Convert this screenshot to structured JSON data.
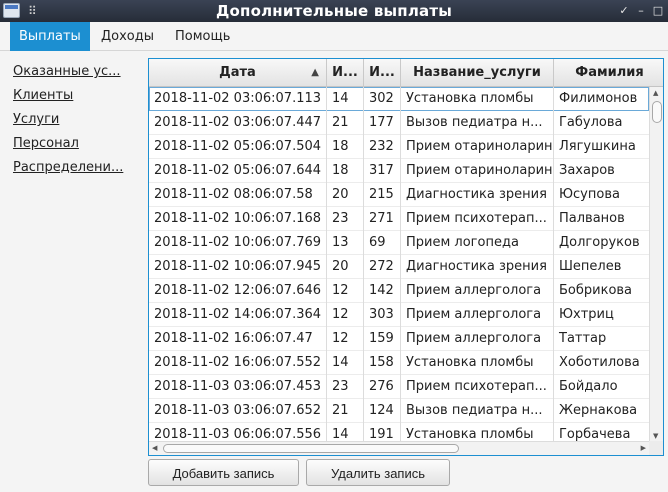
{
  "window": {
    "title": "Дополнительные выплаты",
    "grip_icon": "⠿",
    "pin_icon": "✓",
    "min_icon": "–",
    "max_icon": "□"
  },
  "menu": {
    "items": [
      "Выплаты",
      "Доходы",
      "Помощь"
    ],
    "active": "Выплаты"
  },
  "sidebar": {
    "links": [
      "Оказанные ус...",
      "Клиенты",
      "Услуги",
      "Персонал",
      "Распределени..."
    ]
  },
  "table": {
    "columns": [
      "Дата",
      "И...",
      "И...",
      "Название_услуги",
      "Фамилия"
    ],
    "sorted_column": "Дата",
    "sort_arrow": "▲",
    "rows": [
      [
        "2018-11-02 03:06:07.113",
        "14",
        "302",
        "Установка пломбы",
        "Филимонов"
      ],
      [
        "2018-11-02 03:06:07.447",
        "21",
        "177",
        "Вызов педиатра н...",
        "Габулова"
      ],
      [
        "2018-11-02 05:06:07.504",
        "18",
        "232",
        "Прием отариноларин...",
        "Лягушкина"
      ],
      [
        "2018-11-02 05:06:07.644",
        "18",
        "317",
        "Прием отариноларин...",
        "Захаров"
      ],
      [
        "2018-11-02 08:06:07.58",
        "20",
        "215",
        "Диагностика зрения",
        "Юсупова"
      ],
      [
        "2018-11-02 10:06:07.168",
        "23",
        "271",
        "Прием психотерап...",
        "Палванов"
      ],
      [
        "2018-11-02 10:06:07.769",
        "13",
        "69",
        "Прием логопеда",
        "Долгоруков"
      ],
      [
        "2018-11-02 10:06:07.945",
        "20",
        "272",
        "Диагностика зрения",
        "Шепелев"
      ],
      [
        "2018-11-02 12:06:07.646",
        "12",
        "142",
        "Прием аллерголога",
        "Бобрикова"
      ],
      [
        "2018-11-02 14:06:07.364",
        "12",
        "303",
        "Прием аллерголога",
        "Юхтриц"
      ],
      [
        "2018-11-02 16:06:07.47",
        "12",
        "159",
        "Прием аллерголога",
        "Таттар"
      ],
      [
        "2018-11-02 16:06:07.552",
        "14",
        "158",
        "Установка пломбы",
        "Хоботилова"
      ],
      [
        "2018-11-03 03:06:07.453",
        "23",
        "276",
        "Прием психотерап...",
        "Бойдало"
      ],
      [
        "2018-11-03 03:06:07.652",
        "21",
        "124",
        "Вызов педиатра н...",
        "Жернакова"
      ],
      [
        "2018-11-03 06:06:07.556",
        "14",
        "191",
        "Установка пломбы",
        "Горбачева"
      ]
    ]
  },
  "buttons": {
    "add": "Добавить запись",
    "delete": "Удалить запись"
  },
  "colors": {
    "accent": "#1c8fd1",
    "titlebar": "#2e3441"
  }
}
